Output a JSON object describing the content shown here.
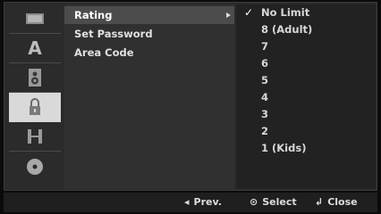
{
  "icons": [
    "disc-setup-icon",
    "language-icon",
    "audio-speaker-icon",
    "lock-icon",
    "film-recording-icon",
    "disc-icon"
  ],
  "menu": {
    "items": [
      {
        "label": "Rating"
      },
      {
        "label": "Set Password"
      },
      {
        "label": "Area Code"
      }
    ]
  },
  "options": {
    "items": [
      "No Limit",
      "8 (Adult)",
      "7",
      "6",
      "5",
      "4",
      "3",
      "2",
      "1 (Kids)"
    ],
    "checked_index": 0
  },
  "footer": {
    "prev_label": "Prev.",
    "select_label": "Select",
    "close_label": "Close"
  },
  "colors": {
    "selected_icon_bg": "#d9d9d9",
    "selected_menu_bg": "#4c4c4c",
    "panel_bg": "#303030"
  }
}
